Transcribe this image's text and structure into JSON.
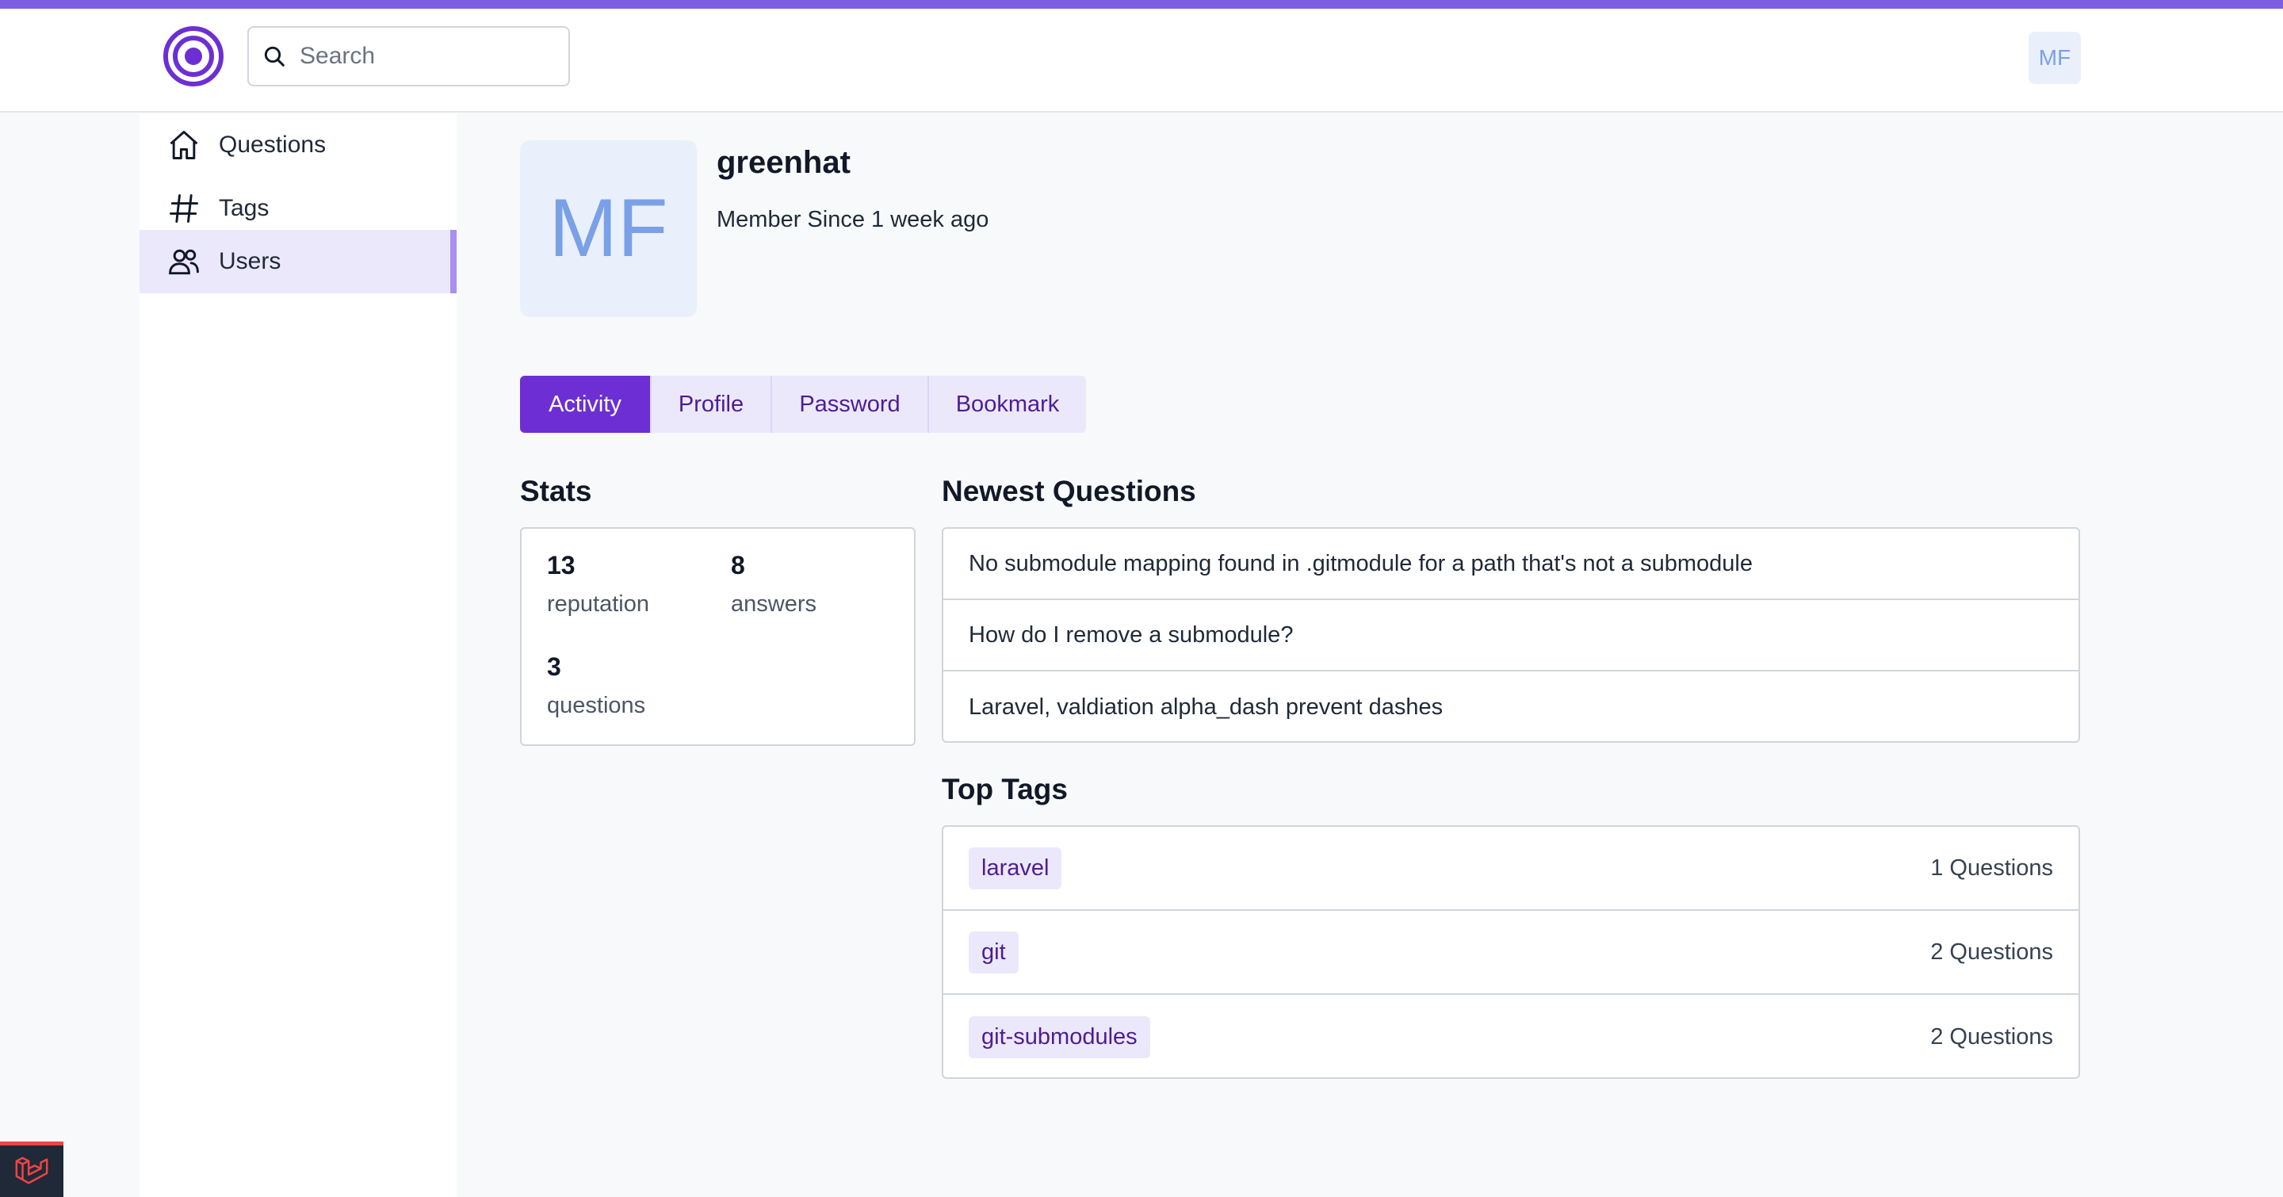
{
  "header": {
    "search_placeholder": "Search",
    "avatar_initials": "MF",
    "logo_icon": "concentric-circles-logo-icon",
    "accent_color": "#7c5fe0"
  },
  "sidebar": {
    "items": [
      {
        "label": "Questions",
        "icon": "home-icon",
        "active": false
      },
      {
        "label": "Tags",
        "icon": "hash-icon",
        "active": false
      },
      {
        "label": "Users",
        "icon": "users-icon",
        "active": true
      }
    ]
  },
  "profile": {
    "avatar_initials": "MF",
    "username": "greenhat",
    "member_since": "Member Since 1 week ago"
  },
  "tabs": [
    {
      "label": "Activity",
      "active": true
    },
    {
      "label": "Profile",
      "active": false
    },
    {
      "label": "Password",
      "active": false
    },
    {
      "label": "Bookmark",
      "active": false
    }
  ],
  "stats": {
    "title": "Stats",
    "reputation": {
      "value": "13",
      "label": "reputation"
    },
    "answers": {
      "value": "8",
      "label": "answers"
    },
    "questions": {
      "value": "3",
      "label": "questions"
    }
  },
  "newest_questions": {
    "title": "Newest Questions",
    "items": [
      "No submodule mapping found in .gitmodule for a path that's not a submodule",
      "How do I remove a submodule?",
      "Laravel, valdiation alpha_dash prevent dashes"
    ]
  },
  "top_tags": {
    "title": "Top Tags",
    "items": [
      {
        "tag": "laravel",
        "count": "1 Questions"
      },
      {
        "tag": "git",
        "count": "2 Questions"
      },
      {
        "tag": "git-submodules",
        "count": "2 Questions"
      }
    ]
  },
  "colors": {
    "primary": "#6d2fd3",
    "tab_bg": "#ece8fb",
    "avatar_bg": "#e9f0fc",
    "avatar_text": "#7aa0e6"
  }
}
